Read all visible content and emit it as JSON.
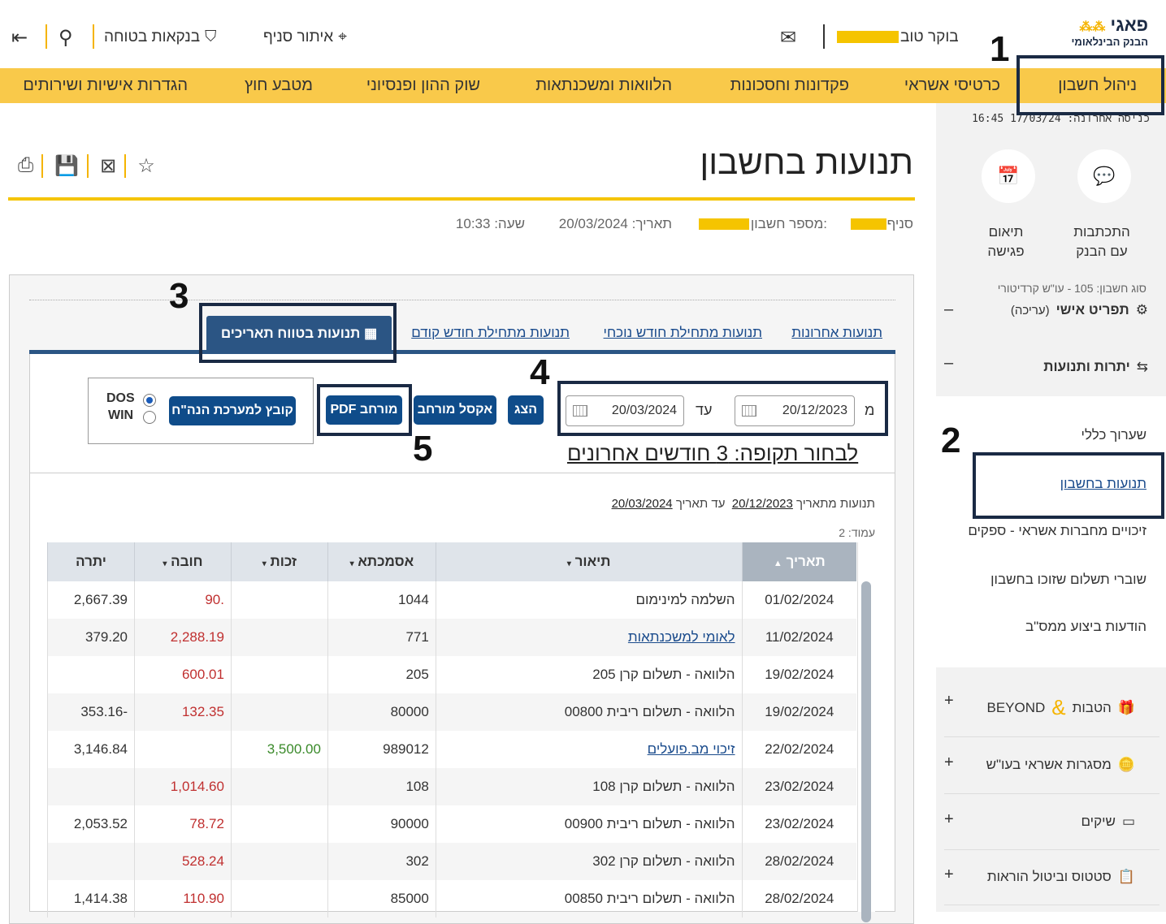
{
  "header": {
    "logo_name": "פאגי",
    "logo_sub": "הבנק הבינלאומי",
    "greeting": "בוקר טוב",
    "branch_locator": "איתור סניף",
    "secure_banking": "בנקאות בטוחה"
  },
  "nav": [
    "ניהול חשבון",
    "כרטיסי אשראי",
    "פקדונות וחסכונות",
    "הלוואות ומשכנתאות",
    "שוק ההון ופנסיוני",
    "מטבע חוץ",
    "הגדרות אישיות ושירותים"
  ],
  "sidebar": {
    "last_login": "כניסה אחרונה: 17/03/24 16:45",
    "contact": "התכתבות\nעם הבנק",
    "meeting": "תיאום\nפגישה",
    "personal_menu": "תפריט אישי",
    "edit": "(עריכה)",
    "balances": "יתרות ותנועות",
    "sub_items": [
      "שערוך כללי",
      "תנועות בחשבון",
      "זיכויים מחברות אשראי - ספקים",
      "שוברי תשלום שזוכו בחשבון",
      "הודעות ביצוע ממס\"ב"
    ],
    "benefits": "הטבות",
    "beyond": "BEYOND",
    "credit_frames": "מסגרות אשראי בעו\"ש",
    "checks": "שיקים",
    "orders": "סטטוס וביטול הוראות"
  },
  "page": {
    "title": "תנועות בחשבון",
    "branch_label": "סניף",
    "account_label": "מספר חשבון:",
    "date_label": "תאריך: 20/03/2024",
    "time_label": "שעה: 10:33",
    "account_type": "סוג חשבון: 105 - עו\"ש קרדיטורי"
  },
  "tabs": [
    "תנועות אחרונות",
    "תנועות מתחילת חודש נוכחי",
    "תנועות מתחילת חודש קודם",
    "תנועות בטווח תאריכים"
  ],
  "filter": {
    "from_label": "מ",
    "to_label": "עד",
    "from_date": "20/12/2023",
    "to_date": "20/03/2024",
    "show_btn": "הצג",
    "excel_btn": "אקסל מורחב",
    "pdf_btn": "PDF מורחב",
    "accounting_btn": "קובץ למערכת הנה\"ח",
    "dos": "DOS",
    "win": "WIN",
    "period_link": "לבחור תקופה: 3 חודשים אחרונים"
  },
  "results": {
    "from_text": "תנועות מתאריך",
    "from_date": "20/12/2023",
    "to_text": "עד תאריך",
    "to_date": "20/03/2024",
    "page": "עמוד: 2"
  },
  "table": {
    "headers": [
      "תאריך",
      "תיאור",
      "אסמכתא",
      "זכות",
      "חובה",
      "יתרה"
    ],
    "rows": [
      [
        "01/02/2024",
        "השלמה למינימום",
        "1044",
        "",
        ".90",
        "2,667.39"
      ],
      [
        "11/02/2024",
        "לאומי למשכנתאות",
        "771",
        "",
        "2,288.19",
        "379.20"
      ],
      [
        "19/02/2024",
        "הלוואה - תשלום קרן 205",
        "205",
        "",
        "600.01",
        ""
      ],
      [
        "19/02/2024",
        "הלוואה - תשלום ריבית 00800",
        "80000",
        "",
        "132.35",
        "-353.16"
      ],
      [
        "22/02/2024",
        "זיכוי מב.פועלים",
        "989012",
        "3,500.00",
        "",
        "3,146.84"
      ],
      [
        "23/02/2024",
        "הלוואה - תשלום קרן 108",
        "108",
        "",
        "1,014.60",
        ""
      ],
      [
        "23/02/2024",
        "הלוואה - תשלום ריבית 00900",
        "90000",
        "",
        "78.72",
        "2,053.52"
      ],
      [
        "28/02/2024",
        "הלוואה - תשלום קרן 302",
        "302",
        "",
        "528.24",
        ""
      ],
      [
        "28/02/2024",
        "הלוואה - תשלום ריבית 00850",
        "85000",
        "",
        "110.90",
        "1,414.38"
      ]
    ]
  },
  "annotations": [
    "1",
    "2",
    "3",
    "4",
    "5"
  ]
}
